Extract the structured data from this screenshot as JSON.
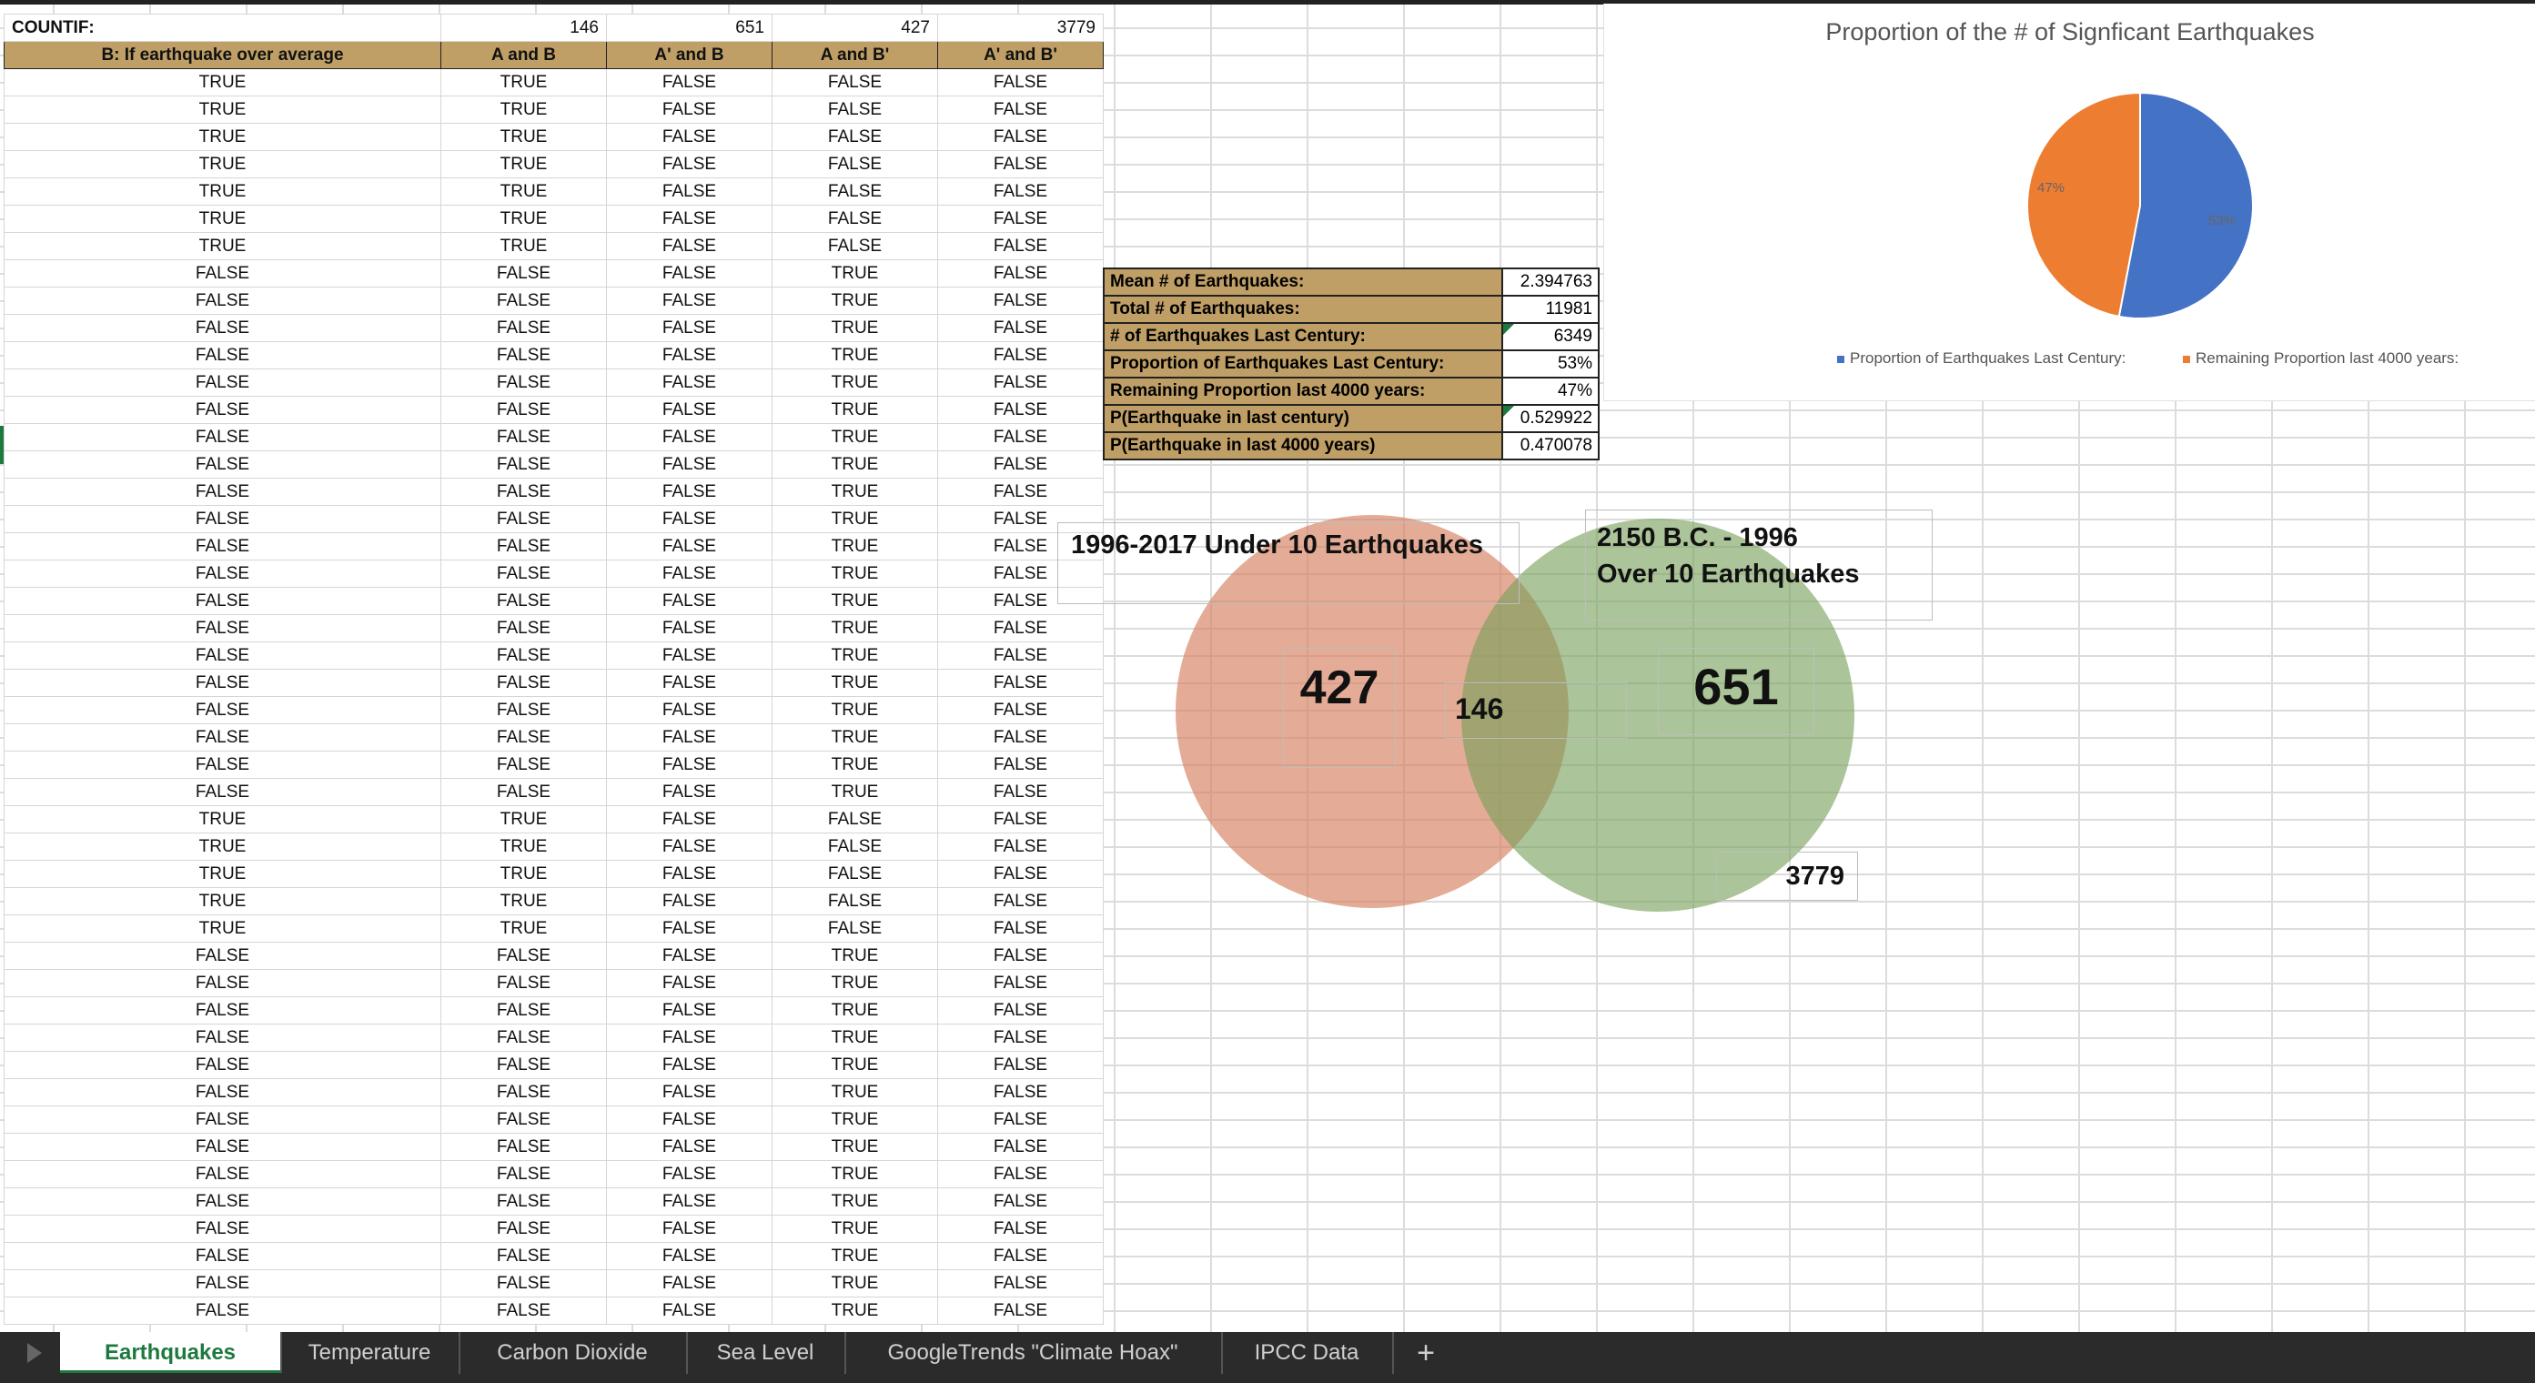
{
  "countif_row": {
    "label": "COUNTIF:",
    "values": [
      "146",
      "651",
      "427",
      "3779"
    ]
  },
  "headers": [
    "B: If earthquake over average",
    "A and B",
    "A' and B",
    "A and B'",
    "A' and B'"
  ],
  "rows": [
    [
      "TRUE",
      "TRUE",
      "FALSE",
      "FALSE",
      "FALSE"
    ],
    [
      "TRUE",
      "TRUE",
      "FALSE",
      "FALSE",
      "FALSE"
    ],
    [
      "TRUE",
      "TRUE",
      "FALSE",
      "FALSE",
      "FALSE"
    ],
    [
      "TRUE",
      "TRUE",
      "FALSE",
      "FALSE",
      "FALSE"
    ],
    [
      "TRUE",
      "TRUE",
      "FALSE",
      "FALSE",
      "FALSE"
    ],
    [
      "TRUE",
      "TRUE",
      "FALSE",
      "FALSE",
      "FALSE"
    ],
    [
      "TRUE",
      "TRUE",
      "FALSE",
      "FALSE",
      "FALSE"
    ],
    [
      "FALSE",
      "FALSE",
      "FALSE",
      "TRUE",
      "FALSE"
    ],
    [
      "FALSE",
      "FALSE",
      "FALSE",
      "TRUE",
      "FALSE"
    ],
    [
      "FALSE",
      "FALSE",
      "FALSE",
      "TRUE",
      "FALSE"
    ],
    [
      "FALSE",
      "FALSE",
      "FALSE",
      "TRUE",
      "FALSE"
    ],
    [
      "FALSE",
      "FALSE",
      "FALSE",
      "TRUE",
      "FALSE"
    ],
    [
      "FALSE",
      "FALSE",
      "FALSE",
      "TRUE",
      "FALSE"
    ],
    [
      "FALSE",
      "FALSE",
      "FALSE",
      "TRUE",
      "FALSE"
    ],
    [
      "FALSE",
      "FALSE",
      "FALSE",
      "TRUE",
      "FALSE"
    ],
    [
      "FALSE",
      "FALSE",
      "FALSE",
      "TRUE",
      "FALSE"
    ],
    [
      "FALSE",
      "FALSE",
      "FALSE",
      "TRUE",
      "FALSE"
    ],
    [
      "FALSE",
      "FALSE",
      "FALSE",
      "TRUE",
      "FALSE"
    ],
    [
      "FALSE",
      "FALSE",
      "FALSE",
      "TRUE",
      "FALSE"
    ],
    [
      "FALSE",
      "FALSE",
      "FALSE",
      "TRUE",
      "FALSE"
    ],
    [
      "FALSE",
      "FALSE",
      "FALSE",
      "TRUE",
      "FALSE"
    ],
    [
      "FALSE",
      "FALSE",
      "FALSE",
      "TRUE",
      "FALSE"
    ],
    [
      "FALSE",
      "FALSE",
      "FALSE",
      "TRUE",
      "FALSE"
    ],
    [
      "FALSE",
      "FALSE",
      "FALSE",
      "TRUE",
      "FALSE"
    ],
    [
      "FALSE",
      "FALSE",
      "FALSE",
      "TRUE",
      "FALSE"
    ],
    [
      "FALSE",
      "FALSE",
      "FALSE",
      "TRUE",
      "FALSE"
    ],
    [
      "FALSE",
      "FALSE",
      "FALSE",
      "TRUE",
      "FALSE"
    ],
    [
      "TRUE",
      "TRUE",
      "FALSE",
      "FALSE",
      "FALSE"
    ],
    [
      "TRUE",
      "TRUE",
      "FALSE",
      "FALSE",
      "FALSE"
    ],
    [
      "TRUE",
      "TRUE",
      "FALSE",
      "FALSE",
      "FALSE"
    ],
    [
      "TRUE",
      "TRUE",
      "FALSE",
      "FALSE",
      "FALSE"
    ],
    [
      "TRUE",
      "TRUE",
      "FALSE",
      "FALSE",
      "FALSE"
    ],
    [
      "FALSE",
      "FALSE",
      "FALSE",
      "TRUE",
      "FALSE"
    ],
    [
      "FALSE",
      "FALSE",
      "FALSE",
      "TRUE",
      "FALSE"
    ],
    [
      "FALSE",
      "FALSE",
      "FALSE",
      "TRUE",
      "FALSE"
    ],
    [
      "FALSE",
      "FALSE",
      "FALSE",
      "TRUE",
      "FALSE"
    ],
    [
      "FALSE",
      "FALSE",
      "FALSE",
      "TRUE",
      "FALSE"
    ],
    [
      "FALSE",
      "FALSE",
      "FALSE",
      "TRUE",
      "FALSE"
    ],
    [
      "FALSE",
      "FALSE",
      "FALSE",
      "TRUE",
      "FALSE"
    ],
    [
      "FALSE",
      "FALSE",
      "FALSE",
      "TRUE",
      "FALSE"
    ],
    [
      "FALSE",
      "FALSE",
      "FALSE",
      "TRUE",
      "FALSE"
    ],
    [
      "FALSE",
      "FALSE",
      "FALSE",
      "TRUE",
      "FALSE"
    ],
    [
      "FALSE",
      "FALSE",
      "FALSE",
      "TRUE",
      "FALSE"
    ],
    [
      "FALSE",
      "FALSE",
      "FALSE",
      "TRUE",
      "FALSE"
    ],
    [
      "FALSE",
      "FALSE",
      "FALSE",
      "TRUE",
      "FALSE"
    ],
    [
      "FALSE",
      "FALSE",
      "FALSE",
      "TRUE",
      "FALSE"
    ]
  ],
  "stats": [
    {
      "label": "Mean # of Earthquakes:",
      "value": "2.394763"
    },
    {
      "label": "Total # of Earthquakes:",
      "value": "11981"
    },
    {
      "label": "# of Earthquakes Last Century:",
      "value": "6349"
    },
    {
      "label": "Proportion of Earthquakes Last Century:",
      "value": "53%"
    },
    {
      "label": "Remaining Proportion last 4000 years:",
      "value": "47%"
    },
    {
      "label": "P(Earthquake in last century)",
      "value": "0.529922"
    },
    {
      "label": "P(Earthquake in last 4000 years)",
      "value": "0.470078"
    }
  ],
  "chart_data": {
    "type": "pie",
    "title": "Proportion of the # of Signficant Earthquakes",
    "categories": [
      "Proportion of Earthquakes Last Century:",
      "Remaining Proportion last 4000 years:"
    ],
    "values": [
      53,
      47
    ],
    "labels": [
      "53%",
      "47%"
    ],
    "colors": [
      "#4472c4",
      "#ed7d31"
    ],
    "legend": "bottom"
  },
  "venn": {
    "left_label": "1996-2017 Under 10 Earthquakes",
    "right_label_line1": "2150 B.C. - 1996",
    "right_label_line2": "Over 10 Earthquakes",
    "left_only": "427",
    "intersection": "146",
    "right_only": "651",
    "outside": "3779",
    "left_color": "#d9967a",
    "right_color": "#96b37a"
  },
  "tabs": {
    "items": [
      "Earthquakes",
      "Temperature",
      "Carbon Dioxide",
      "Sea Level",
      "GoogleTrends \"Climate Hoax\"",
      "IPCC Data"
    ],
    "add": "+"
  }
}
